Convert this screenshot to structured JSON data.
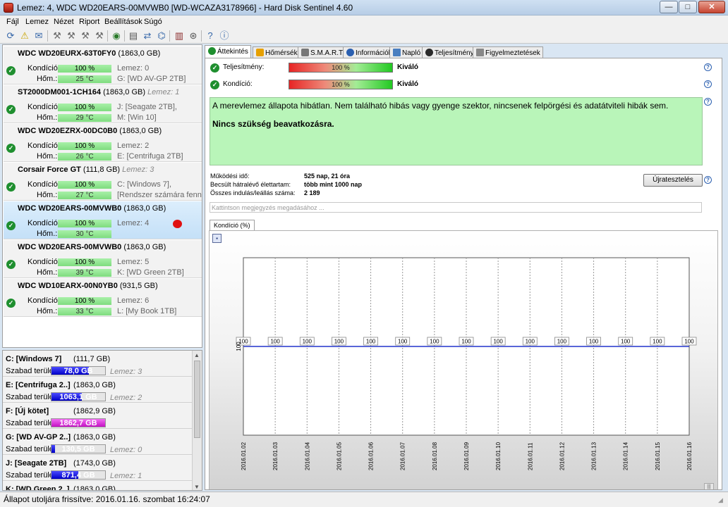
{
  "window": {
    "title": "Lemez: 4, WDC WD20EARS-00MVWB0 [WD-WCAZA3178966]  -  Hard Disk Sentinel 4.60",
    "min": "—",
    "max": "□",
    "close": "✕"
  },
  "menu": [
    "Fájl",
    "Lemez",
    "Nézet",
    "Riport",
    "Beállítások",
    "Súgó"
  ],
  "disks": [
    {
      "name": "WDC WD20EURX-63T0FY0",
      "size": "(1863,0 GB)",
      "lemez": "",
      "kond_label": "Kondíció:",
      "kond": "100 %",
      "hom_label": "Hőm.:",
      "hom": "25 °C",
      "info1": "Lemez: 0",
      "info2": "G: [WD AV-GP 2TB]"
    },
    {
      "name": "ST2000DM001-1CH164",
      "size": "(1863,0 GB)",
      "lemez": "Lemez: 1",
      "kond_label": "Kondíció:",
      "kond": "100 %",
      "hom_label": "Hőm.:",
      "hom": "29 °C",
      "info1": "J: [Seagate 2TB],",
      "info2": "M: [Win 10]"
    },
    {
      "name": "WDC WD20EZRX-00DC0B0",
      "size": "(1863,0 GB)",
      "lemez": "",
      "kond_label": "Kondíció:",
      "kond": "100 %",
      "hom_label": "Hőm.:",
      "hom": "26 °C",
      "info1": "Lemez: 2",
      "info2": "E: [Centrifuga 2TB]"
    },
    {
      "name": "Corsair Force GT",
      "size": "(111,8 GB)",
      "lemez": "Lemez: 3",
      "kond_label": "Kondíció:",
      "kond": "100 %",
      "hom_label": "Hőm.:",
      "hom": "27 °C",
      "info1": "C: [Windows 7],",
      "info2": "[Rendszer számára fenntart"
    },
    {
      "name": "WDC WD20EARS-00MVWB0",
      "size": "(1863,0 GB)",
      "lemez": "",
      "kond_label": "Kondíció:",
      "kond": "100 %",
      "hom_label": "Hőm.:",
      "hom": "30 °C",
      "info1": "Lemez: 4",
      "info2": ""
    },
    {
      "name": "WDC WD20EARS-00MVWB0",
      "size": "(1863,0 GB)",
      "lemez": "",
      "kond_label": "Kondíció:",
      "kond": "100 %",
      "hom_label": "Hőm.:",
      "hom": "39 °C",
      "info1": "Lemez: 5",
      "info2": "K: [WD Green 2TB]"
    },
    {
      "name": "WDC WD10EARX-00N0YB0",
      "size": "(931,5 GB)",
      "lemez": "",
      "kond_label": "Kondíció:",
      "kond": "100 %",
      "hom_label": "Hőm.:",
      "hom": "33 °C",
      "info1": "Lemez: 6",
      "info2": "L: [My Book 1TB]"
    }
  ],
  "volumes": [
    {
      "name": "C: [Windows 7]",
      "size": "(111,7 GB)",
      "free_label": "Szabad terület",
      "free": "78,0 GB",
      "fill": 0.7,
      "color": "blue",
      "lemez": "Lemez: 3"
    },
    {
      "name": "E: [Centrifuga 2..]",
      "size": "(1863,0 GB)",
      "free_label": "Szabad terület",
      "free": "1063,1 GB",
      "fill": 0.57,
      "color": "blue",
      "lemez": "Lemez: 2"
    },
    {
      "name": "F: [Új kötet]",
      "size": "(1862,9 GB)",
      "free_label": "Szabad terület",
      "free": "1862,7 GB",
      "fill": 1.0,
      "color": "magenta",
      "lemez": ""
    },
    {
      "name": "G: [WD AV-GP 2..]",
      "size": "(1863,0 GB)",
      "free_label": "Szabad terület",
      "free": "130,5 GB",
      "fill": 0.07,
      "color": "blue",
      "lemez": "Lemez: 0"
    },
    {
      "name": "J: [Seagate 2TB]",
      "size": "(1743,0 GB)",
      "free_label": "Szabad terület",
      "free": "871,4 GB",
      "fill": 0.5,
      "color": "blue",
      "lemez": "Lemez: 1"
    },
    {
      "name": "K: [WD Green 2..]",
      "size": "(1863,0 GB)",
      "free_label": "",
      "free": "",
      "fill": 0,
      "color": "blue",
      "lemez": ""
    }
  ],
  "tabs": [
    "Áttekintés",
    "Hőmérséklet",
    "S.M.A.R.T.",
    "Információk",
    "Napló",
    "Teljesítmény",
    "Figyelmeztetések"
  ],
  "overview": {
    "perf_label": "Teljesítmény:",
    "perf_value": "100 %",
    "perf_status": "Kiváló",
    "cond_label": "Kondíció:",
    "cond_value": "100 %",
    "cond_status": "Kiváló",
    "message1": "A merevlemez állapota hibátlan. Nem található hibás vagy gyenge szektor, nincsenek felpörgési és adatátviteli hibák sem.",
    "message2": "Nincs szükség beavatkozásra.",
    "uptime_label": "Működési idő:",
    "uptime": "525 nap, 21 óra",
    "remaining_label": "Becsült hátralévő élettartam:",
    "remaining": "több mint 1000 nap",
    "starts_label": "Összes indulás/leállás száma:",
    "starts": "2 189",
    "retest": "Újratesztelés",
    "note_placeholder": "Kattintson megjegyzés megadásához ..."
  },
  "chart_tab": "Kondíció  (%)",
  "chart_data": {
    "type": "line",
    "x": [
      "2016.01.02",
      "2016.01.03",
      "2016.01.04",
      "2016.01.05",
      "2016.01.06",
      "2016.01.07",
      "2016.01.08",
      "2016.01.09",
      "2016.01.10",
      "2016.01.11",
      "2016.01.12",
      "2016.01.13",
      "2016.01.14",
      "2016.01.15",
      "2016.01.16"
    ],
    "series": [
      {
        "values": [
          100,
          100,
          100,
          100,
          100,
          100,
          100,
          100,
          100,
          100,
          100,
          100,
          100,
          100,
          100
        ]
      }
    ],
    "y_tick": "100",
    "line_color": "#2233cc"
  },
  "status": "Állapot utoljára frissítve: 2016.01.16. szombat 16:24:07"
}
